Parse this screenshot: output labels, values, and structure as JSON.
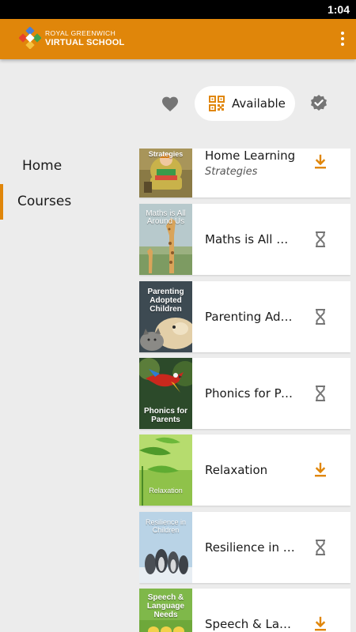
{
  "status_bar": {
    "time": "1:04"
  },
  "app_bar": {
    "brand_line1": "ROYAL GREENWICH",
    "brand_line2": "VIRTUAL SCHOOL",
    "menu_icon": "more-vert-icon",
    "color": "#e0860a"
  },
  "filters": {
    "favorites_icon": "heart-icon",
    "available_label": "Available",
    "available_icon": "qr-code-icon",
    "completed_icon": "verified-badge-icon"
  },
  "nav": {
    "items": [
      {
        "label": "Home",
        "selected": false
      },
      {
        "label": "Courses",
        "selected": true
      }
    ]
  },
  "courses": [
    {
      "title": "Home Learning",
      "subtitle": "Strategies",
      "thumb_label": "Strategies",
      "status": "download-icon"
    },
    {
      "title": "Maths is All Ar…",
      "thumb_label": "Maths is All Around Us",
      "status": "hourglass-icon"
    },
    {
      "title": "Parenting Ado…",
      "thumb_label": "Parenting Adopted Children",
      "status": "hourglass-icon"
    },
    {
      "title": "Phonics for Pa…",
      "thumb_label": "Phonics for Parents",
      "status": "hourglass-icon"
    },
    {
      "title": "Relaxation",
      "thumb_label": "Relaxation",
      "status": "download-icon"
    },
    {
      "title": "Resilience in …",
      "thumb_label": "Resilience in Children",
      "status": "hourglass-icon"
    },
    {
      "title": "Speech & Lan…",
      "thumb_label": "Speech & Language Needs",
      "status": "download-icon"
    }
  ],
  "colors": {
    "accent": "#e0860a",
    "icon_grey": "#757575",
    "background": "#ececec"
  }
}
